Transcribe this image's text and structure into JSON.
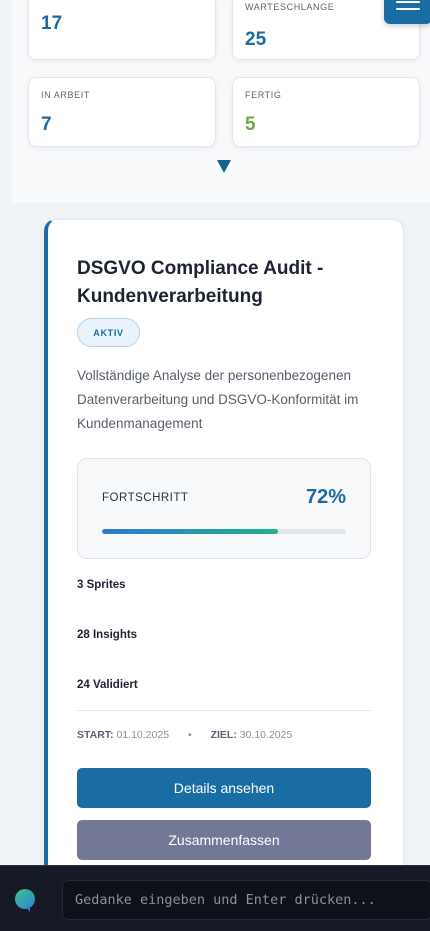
{
  "stats": {
    "total": {
      "label": "",
      "value": "17"
    },
    "queue": {
      "label": "WARTESCHLANGE",
      "value": "25"
    },
    "in_progress": {
      "label": "IN ARBEIT",
      "value": "7"
    },
    "done": {
      "label": "FERTIG",
      "value": "5"
    }
  },
  "project": {
    "title": "DSGVO Compliance Audit - Kundenverarbeitung",
    "status": "AKTIV",
    "description": "Vollständige Analyse der personenbezogenen Datenverarbeitung und DSGVO-Konformität im Kundenmanagement",
    "progress_label": "FORTSCHRITT",
    "progress_text": "72%",
    "progress_fraction": 0.72,
    "metrics": [
      "3 Sprites",
      "28 Insights",
      "24 Validiert"
    ],
    "start_label": "START:",
    "start_date": "01.10.2025",
    "separator": "•",
    "target_label": "ZIEL:",
    "target_date": "30.10.2025",
    "details_button": "Details ansehen",
    "summarize_button": "Zusammenfassen"
  },
  "bottom_bar": {
    "input_placeholder": "Gedanke eingeben und Enter drücken..."
  },
  "colors": {
    "accent": "#1a6da3",
    "done_green": "#6aa84f",
    "secondary_button": "#737896"
  },
  "icons": {
    "menu": "hamburger-icon",
    "expand": "triangle-down-icon",
    "chat": "chat-bubble-icon"
  }
}
